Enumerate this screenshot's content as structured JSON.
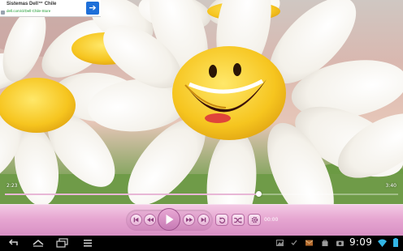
{
  "ad": {
    "title": "Sistemas Dell™ Chile",
    "url": "dell.com/cl/Dell-Chile-Store",
    "go_icon": "arrow-right-icon",
    "accent": "#1e6fd8"
  },
  "player": {
    "elapsed": "2:23",
    "total": "3:40",
    "progress": 0.645,
    "timer": "00:00",
    "accent": "#e6a6d1",
    "buttons": [
      "skip-previous-icon",
      "rewind-icon",
      "play-icon",
      "fast-forward-icon",
      "skip-next-icon",
      "repeat-icon",
      "shuffle-icon",
      "settings-gear-icon"
    ]
  },
  "system_bar": {
    "clock": "9:09",
    "nav_icons": [
      "back-icon",
      "home-icon",
      "recent-apps-icon",
      "menu-icon"
    ],
    "status_icons": [
      "gallery-icon",
      "check-icon",
      "mail-icon",
      "bag-icon",
      "camera-icon",
      "bag-icon",
      "wifi-icon",
      "battery-icon"
    ]
  }
}
